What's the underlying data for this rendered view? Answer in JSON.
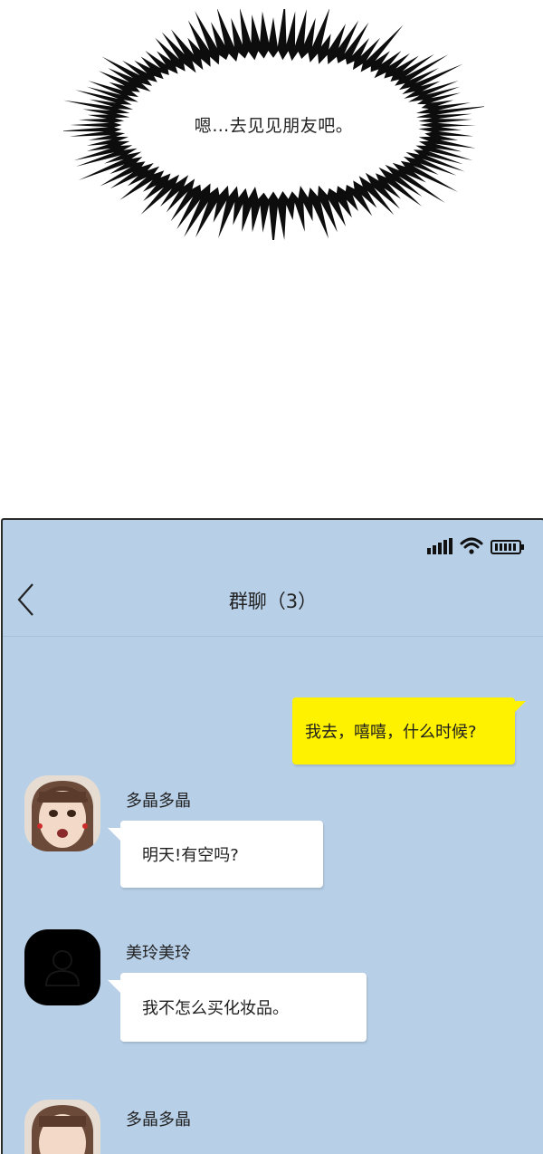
{
  "thought_bubble": {
    "text": "嗯…去见见朋友吧。"
  },
  "status_bar": {
    "signal_icon": "signal-bars-icon",
    "wifi_icon": "wifi-icon",
    "battery_icon": "battery-icon"
  },
  "chat": {
    "back_icon": "chevron-left-icon",
    "title": "群聊（3）",
    "messages": [
      {
        "sender": "me",
        "text": "我去，嘻嘻，什么时候?"
      },
      {
        "sender": "多晶多晶",
        "text": "明天!有空吗?"
      },
      {
        "sender": "美玲美玲",
        "text": "我不怎么买化妆品。"
      },
      {
        "sender": "多晶多晶",
        "text": ""
      }
    ]
  },
  "colors": {
    "chat_background": "#b7cfe7",
    "own_bubble": "#fff200",
    "other_bubble": "#ffffff"
  }
}
